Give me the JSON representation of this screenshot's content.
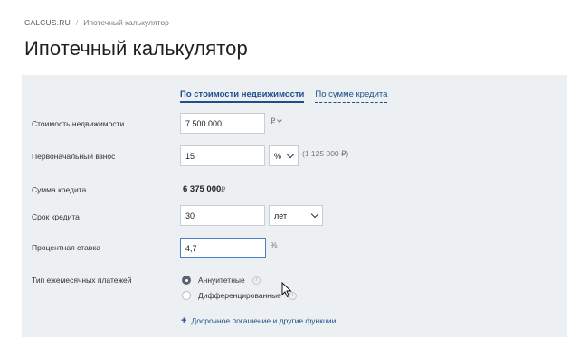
{
  "breadcrumb": {
    "site": "CALCUS.RU",
    "separator": "/",
    "current": "Ипотечный калькулятор"
  },
  "page_title": "Ипотечный калькулятор",
  "tabs": [
    {
      "label": "По стоимости недвижимости",
      "active": true
    },
    {
      "label": "По сумме кредита",
      "active": false
    }
  ],
  "form": {
    "property_cost": {
      "label": "Стоимость недвижимости",
      "value": "7 500 000",
      "unit": "₽"
    },
    "down_payment": {
      "label": "Первоначальный взнос",
      "value": "15",
      "unit_select": "%",
      "hint": "(1 125 000 ₽)"
    },
    "loan_amount": {
      "label": "Сумма кредита",
      "value": "6 375 000",
      "unit": "₽"
    },
    "loan_term": {
      "label": "Срок кредита",
      "value": "30",
      "unit_select": "лет"
    },
    "interest_rate": {
      "label": "Процентная ставка",
      "value": "4,7",
      "unit": "%"
    },
    "payment_type": {
      "label": "Тип ежемесячных платежей",
      "options": [
        {
          "label": "Аннуитетные",
          "checked": true
        },
        {
          "label": "Дифференцированные",
          "checked": false
        }
      ],
      "info_glyph": "i"
    }
  },
  "more_link": {
    "icon": "plus-icon",
    "label": "Досрочное погашение и другие функции"
  },
  "colors": {
    "panel_bg": "#edf0f3",
    "accent": "#1e4e8c",
    "radio_checked": "#5a6470"
  }
}
